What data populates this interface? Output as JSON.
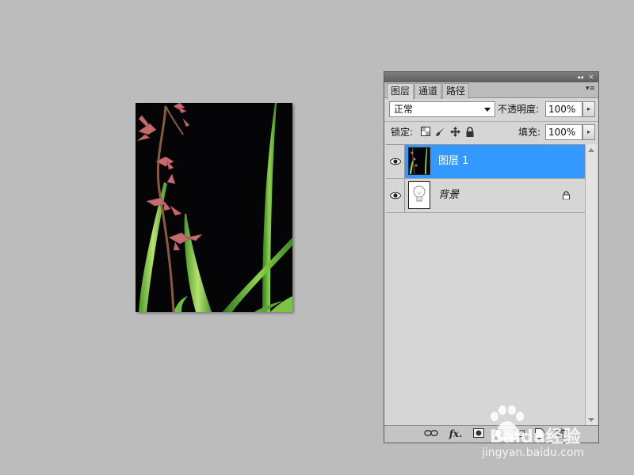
{
  "panel": {
    "title_controls": {
      "collapse": "◂◂",
      "close": "✕"
    },
    "tabs": [
      "图层",
      "通道",
      "路径"
    ],
    "active_tab": 0,
    "menu_glyph": "▾≡"
  },
  "options": {
    "blend_mode": "正常",
    "opacity_label": "不透明度:",
    "opacity_value": "100%",
    "lock_label": "锁定:",
    "fill_label": "填充:",
    "fill_value": "100%"
  },
  "layers": [
    {
      "name": "图层 1",
      "visible": true,
      "selected": true,
      "thumbnail": "orchid-photo"
    },
    {
      "name": "背景",
      "visible": true,
      "selected": false,
      "italic": true,
      "locked": true,
      "thumbnail": "lightbulb"
    }
  ],
  "bottom_icons": [
    "link-icon",
    "fx-icon",
    "mask-icon",
    "adjustment-icon",
    "group-icon",
    "new-layer-icon",
    "trash-icon"
  ],
  "watermark": {
    "brand": "Baidu经验",
    "url": "jingyan.baidu.com"
  },
  "colors": {
    "selection": "#3399ff",
    "workspace": "#bcbcbc",
    "panel": "#d6d6d6"
  }
}
